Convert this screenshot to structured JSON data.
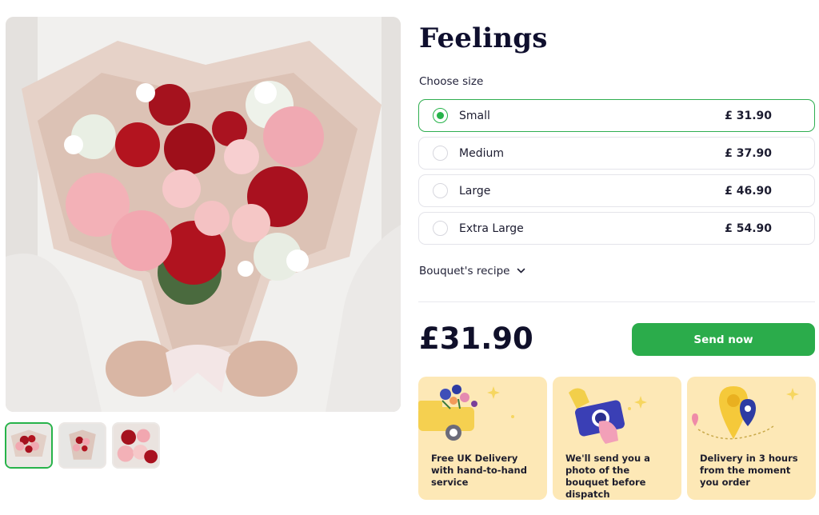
{
  "product": {
    "title": "Feelings",
    "choose_size_label": "Choose size",
    "sizes": [
      {
        "name": "Small",
        "price": "£ 31.90",
        "selected": true
      },
      {
        "name": "Medium",
        "price": "£ 37.90",
        "selected": false
      },
      {
        "name": "Large",
        "price": "£ 46.90",
        "selected": false
      },
      {
        "name": "Extra Large",
        "price": "£ 54.90",
        "selected": false
      }
    ],
    "recipe_label": "Bouquet's recipe",
    "price": "£31.90",
    "send_button": "Send now"
  },
  "gallery": {
    "main_image": "bouquet-photo",
    "thumbnails": 3,
    "active_thumbnail": 1
  },
  "features": [
    {
      "icon": "delivery-car-icon",
      "text": "Free UK Delivery with hand-to-hand service"
    },
    {
      "icon": "camera-photo-icon",
      "text": "We'll send you a photo of the bouquet before dispatch"
    },
    {
      "icon": "location-pin-icon",
      "text": "Delivery in 3 hours from the moment you order"
    }
  ],
  "colors": {
    "accent": "#2bac4b",
    "card_bg": "#fde8b6",
    "title": "#0f0f2e"
  }
}
